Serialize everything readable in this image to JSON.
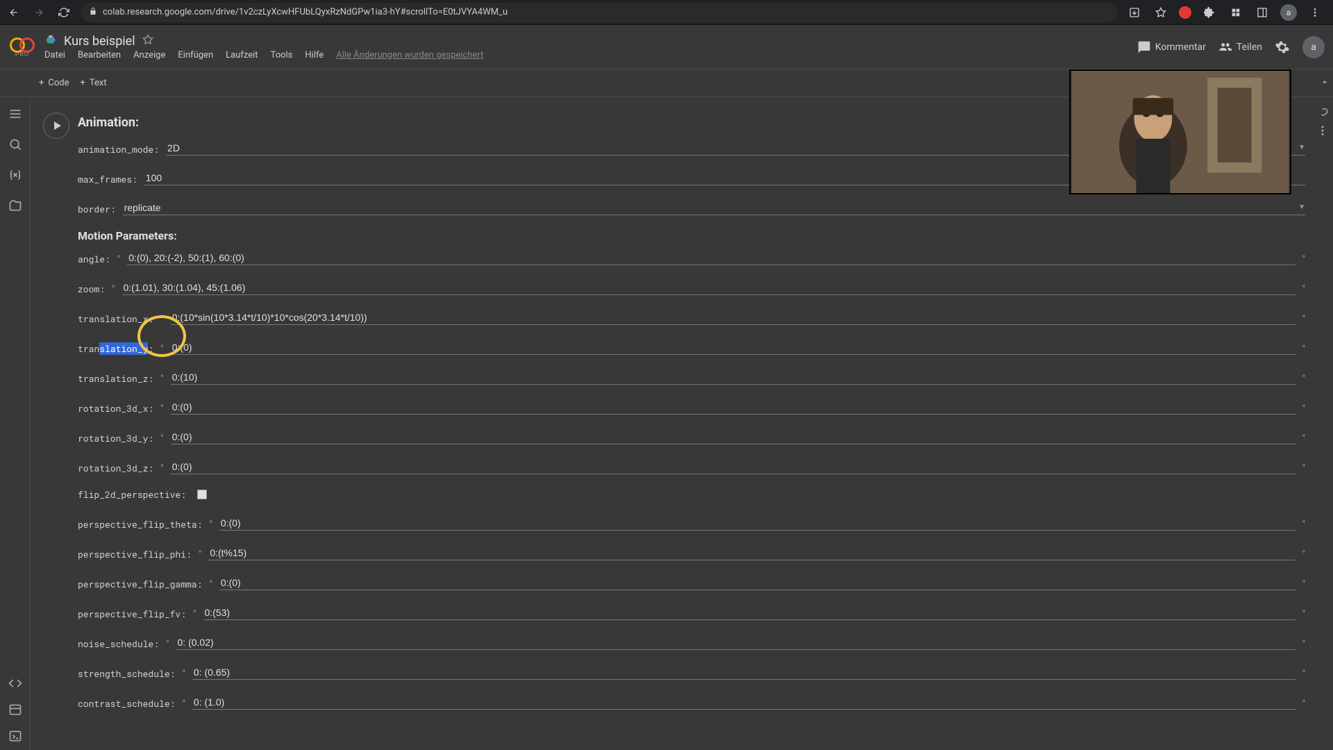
{
  "browser": {
    "url": "colab.research.google.com/drive/1v2czLyXcwHFUbLQyxRzNdGPw1ia3-hY#scrollTo=E0tJVYA4WM_u"
  },
  "header": {
    "title": "Kurs beispiel",
    "pro": "PRO",
    "menu": [
      "Datei",
      "Bearbeiten",
      "Anzeige",
      "Einfügen",
      "Laufzeit",
      "Tools",
      "Hilfe"
    ],
    "save_status": "Alle Änderungen wurden gespeichert",
    "comment": "Kommentar",
    "share": "Teilen",
    "avatar": "a"
  },
  "toolbar": {
    "code": "Code",
    "text": "Text"
  },
  "sections": {
    "animation_title": "Animation:",
    "motion_title": "Motion Parameters:"
  },
  "fields": {
    "animation_mode": {
      "label": "animation_mode:",
      "value": "2D"
    },
    "max_frames": {
      "label": "max_frames:",
      "value": "100"
    },
    "border": {
      "label": "border:",
      "value": "replicate"
    },
    "angle": {
      "label": "angle:",
      "value": "0:(0), 20:(-2), 50:(1), 60:(0)"
    },
    "zoom": {
      "label": "zoom:",
      "value": "0:(1.01), 30:(1.04), 45:(1.06)"
    },
    "translation_x": {
      "label": "translation_x:",
      "value": "0:(10*sin(10*3.14*t/10)*10*cos(20*3.14*t/10))"
    },
    "translation_y": {
      "label": "translation_y:",
      "value": "0:(0)"
    },
    "translation_z": {
      "label": "translation_z:",
      "value": "0:(10)"
    },
    "rotation_3d_x": {
      "label": "rotation_3d_x:",
      "value": "0:(0)"
    },
    "rotation_3d_y": {
      "label": "rotation_3d_y:",
      "value": "0:(0)"
    },
    "rotation_3d_z": {
      "label": "rotation_3d_z:",
      "value": "0:(0)"
    },
    "flip_2d_perspective": {
      "label": "flip_2d_perspective:"
    },
    "perspective_flip_theta": {
      "label": "perspective_flip_theta:",
      "value": "0:(0)"
    },
    "perspective_flip_phi": {
      "label": "perspective_flip_phi:",
      "value": "0:(t%15)"
    },
    "perspective_flip_gamma": {
      "label": "perspective_flip_gamma:",
      "value": "0:(0)"
    },
    "perspective_flip_fv": {
      "label": "perspective_flip_fv:",
      "value": "0:(53)"
    },
    "noise_schedule": {
      "label": "noise_schedule:",
      "value": "0: (0.02)"
    },
    "strength_schedule": {
      "label": "strength_schedule:",
      "value": "0: (0.65)"
    },
    "contrast_schedule": {
      "label": "contrast_schedule:",
      "value": "0: (1.0)"
    }
  }
}
